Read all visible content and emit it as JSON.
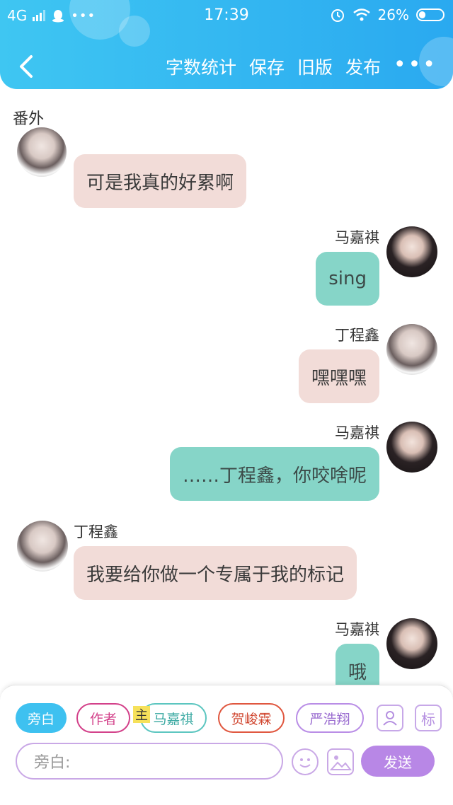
{
  "statusbar": {
    "network": "4G",
    "time": "17:39",
    "battery": "26%"
  },
  "nav": {
    "items": [
      "字数统计",
      "保存",
      "旧版",
      "发布"
    ],
    "more": "•••"
  },
  "chapter": "番外",
  "messages": [
    {
      "side": "left",
      "name": "",
      "text": "可是我真的好累啊",
      "color": "pink"
    },
    {
      "side": "right",
      "name": "马嘉祺",
      "text": "sing",
      "color": "teal"
    },
    {
      "side": "right",
      "name": "丁程鑫",
      "text": "嘿嘿嘿",
      "color": "pink"
    },
    {
      "side": "right",
      "name": "马嘉祺",
      "text": "……丁程鑫，你咬啥呢",
      "color": "teal"
    },
    {
      "side": "left",
      "name": "丁程鑫",
      "text": "我要给你做一个专属于我的标记",
      "color": "pink"
    },
    {
      "side": "right",
      "name": "马嘉祺",
      "text": "哦",
      "color": "teal"
    }
  ],
  "roles": {
    "narration": "旁白",
    "author": "作者",
    "main_tag": "主",
    "role1": "马嘉祺",
    "role2": "贺峻霖",
    "role3": "严浩翔",
    "mark_icon": "标"
  },
  "composer": {
    "placeholder": "旁白:",
    "send": "发送"
  },
  "colors": {
    "header": "#33b6f1",
    "pink_bubble": "#f2dcd8",
    "teal_bubble": "#86d5c8",
    "accent_purple": "#b887e6"
  },
  "icons": [
    "back-icon",
    "qq-icon",
    "alarm-icon",
    "wifi-icon",
    "battery-icon",
    "more-icon",
    "person-icon",
    "emoji-icon",
    "image-icon"
  ]
}
